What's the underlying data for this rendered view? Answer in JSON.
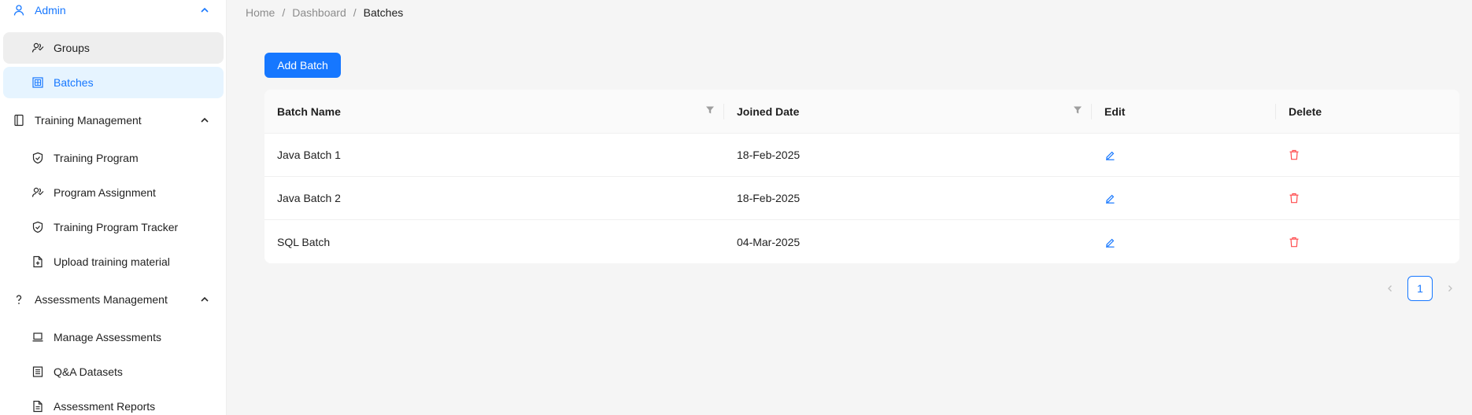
{
  "sidebar": {
    "admin": {
      "label": "Admin",
      "icon": "user-icon"
    },
    "admin_items": [
      {
        "label": "Groups",
        "icon": "users-icon"
      },
      {
        "label": "Batches",
        "icon": "table-icon"
      }
    ],
    "training": {
      "label": "Training Management",
      "icon": "book-icon"
    },
    "training_items": [
      {
        "label": "Training Program",
        "icon": "shield-check-icon"
      },
      {
        "label": "Program Assignment",
        "icon": "users-icon"
      },
      {
        "label": "Training Program Tracker",
        "icon": "shield-check-icon"
      },
      {
        "label": "Upload training material",
        "icon": "file-add-icon"
      }
    ],
    "assessments": {
      "label": "Assessments Management",
      "icon": "question-icon"
    },
    "assessment_items": [
      {
        "label": "Manage Assessments",
        "icon": "laptop-icon"
      },
      {
        "label": "Q&A Datasets",
        "icon": "list-icon"
      },
      {
        "label": "Assessment Reports",
        "icon": "file-text-icon"
      }
    ]
  },
  "breadcrumb": {
    "home": "Home",
    "dashboard": "Dashboard",
    "current": "Batches",
    "separator": "/"
  },
  "toolbar": {
    "add_label": "Add Batch"
  },
  "table": {
    "headers": {
      "batch_name": "Batch Name",
      "joined_date": "Joined Date",
      "edit": "Edit",
      "delete": "Delete"
    },
    "rows": [
      {
        "batch_name": "Java Batch 1",
        "joined_date": "18-Feb-2025"
      },
      {
        "batch_name": "Java Batch 2",
        "joined_date": "18-Feb-2025"
      },
      {
        "batch_name": "SQL Batch",
        "joined_date": "04-Mar-2025"
      }
    ]
  },
  "pagination": {
    "current_page": "1"
  },
  "colors": {
    "accent": "#1677ff",
    "danger": "#ff4d4f",
    "selected_bg": "#e6f4ff"
  }
}
